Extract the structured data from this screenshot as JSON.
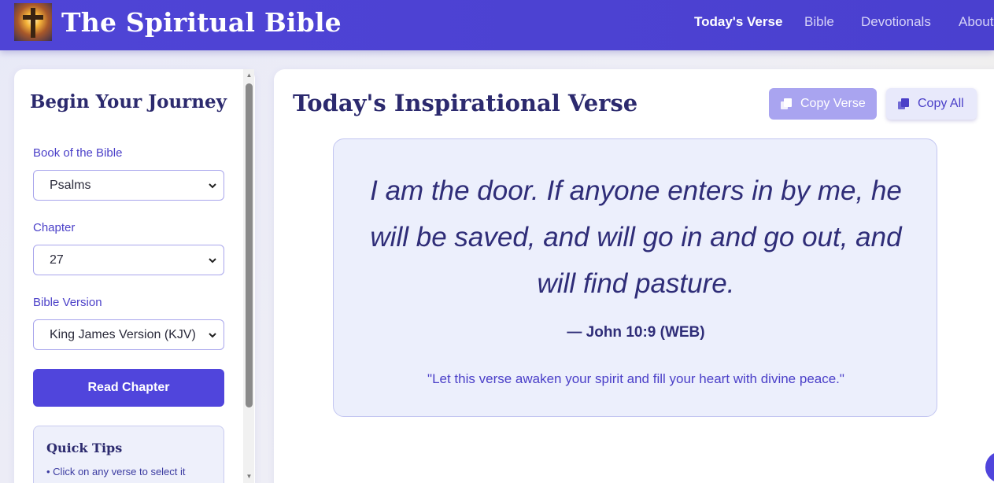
{
  "header": {
    "brand": "The Spiritual Bible",
    "nav": [
      {
        "label": "Today's Verse",
        "active": true
      },
      {
        "label": "Bible",
        "active": false
      },
      {
        "label": "Devotionals",
        "active": false
      },
      {
        "label": "About",
        "active": false
      }
    ]
  },
  "sidebar": {
    "title": "Begin Your Journey",
    "book_label": "Book of the Bible",
    "book_value": "Psalms",
    "chapter_label": "Chapter",
    "chapter_value": "27",
    "version_label": "Bible Version",
    "version_value": "King James Version (KJV)",
    "read_button": "Read Chapter",
    "tips_title": "Quick Tips",
    "tips_items": [
      "• Click on any verse to select it"
    ]
  },
  "main": {
    "title": "Today's Inspirational Verse",
    "copy_verse": "Copy Verse",
    "copy_all": "Copy All",
    "verse_text": "I am the door. If anyone enters in by me, he will be saved, and will go in and go out, and will find pasture.",
    "verse_ref": "— John 10:9 (WEB)",
    "verse_quote": "\"Let this verse awaken your spirit and fill your heart with divine peace.\""
  },
  "colors": {
    "brand": "#4f44d6",
    "accent": "#5045dc",
    "heading": "#2c2a6e",
    "verse_bg": "#eceffc"
  },
  "icons": {
    "logo": "cross-sunrise-logo",
    "copy": "copy-icon",
    "select": "chevron-down-icon"
  }
}
